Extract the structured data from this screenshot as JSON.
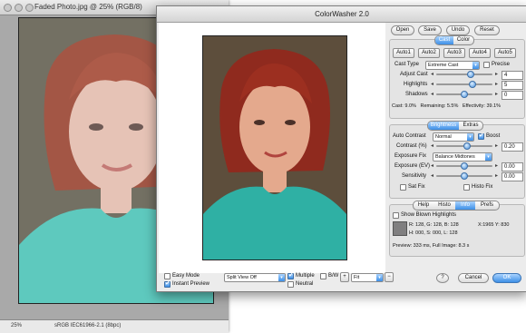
{
  "bg_window": {
    "title": "Faded Photo.jpg @ 25% (RGB/8)",
    "zoom": "25%",
    "profile": "sRGB IEC61966-2.1 (8bpc)"
  },
  "dialog": {
    "title": "ColorWasher 2.0",
    "top_buttons": [
      "Open",
      "Save",
      "Undo",
      "Reset"
    ],
    "cast_tabs": [
      "Cast",
      "Color"
    ],
    "auto_buttons": [
      "Auto1",
      "Auto2",
      "Auto3",
      "Auto4",
      "Auto5"
    ],
    "cast_type": {
      "label": "Cast Type",
      "value": "Extreme Cast",
      "precise_label": "Precise"
    },
    "adjust_cast": {
      "label": "Adjust Cast",
      "value": "4",
      "level": 0.62
    },
    "highlights": {
      "label": "Highlights",
      "value": "5",
      "level": 0.64
    },
    "shadows": {
      "label": "Shadows",
      "value": "0",
      "level": 0.5
    },
    "cast_status": {
      "cast": "Cast: 9.0%",
      "remaining": "Remaining: 5.5%",
      "effectivity": "Effectivity: 39.1%"
    },
    "brightness_tabs": [
      "Brightness",
      "Extras"
    ],
    "auto_contrast": {
      "label": "Auto Contrast",
      "value": "Normal",
      "boost_label": "Boost"
    },
    "contrast": {
      "label": "Contrast (%)",
      "value": "0.20",
      "level": 0.55
    },
    "exposure_fix": {
      "label": "Exposure Fix",
      "value": "Balance Midtones"
    },
    "exposure": {
      "label": "Exposure (EV)",
      "value": "0.00",
      "level": 0.5
    },
    "sensitivity": {
      "label": "Sensitivity",
      "value": "0.00",
      "level": 0.5
    },
    "sat_fix_label": "Sat Fix",
    "histo_fix_label": "Histo Fix",
    "info_tabs": [
      "Help",
      "Histo",
      "Info",
      "Prefs"
    ],
    "show_blown_label": "Show Blown Highlights",
    "info_color": "R: 128, G: 128, B: 128",
    "info_xy": "X:1965  Y: 830",
    "info_hsl": "H: 000, S: 000, L: 128",
    "preview_time": "Preview: 333 ms, Full Image: 8.3 s",
    "bottom": {
      "easy_mode": "Easy Mode",
      "instant_preview": "Instant Preview",
      "split_view": "Split View Off",
      "multiple": "Multiple",
      "neutral": "Neutral",
      "bw": "B/W",
      "fit": "Fit",
      "help_btn": "?",
      "cancel": "Cancel",
      "ok": "OK"
    }
  },
  "colors": {
    "accent": "#3d8fe6",
    "dialog_bg": "#ececec",
    "photo_bg": "#6e5a43"
  }
}
